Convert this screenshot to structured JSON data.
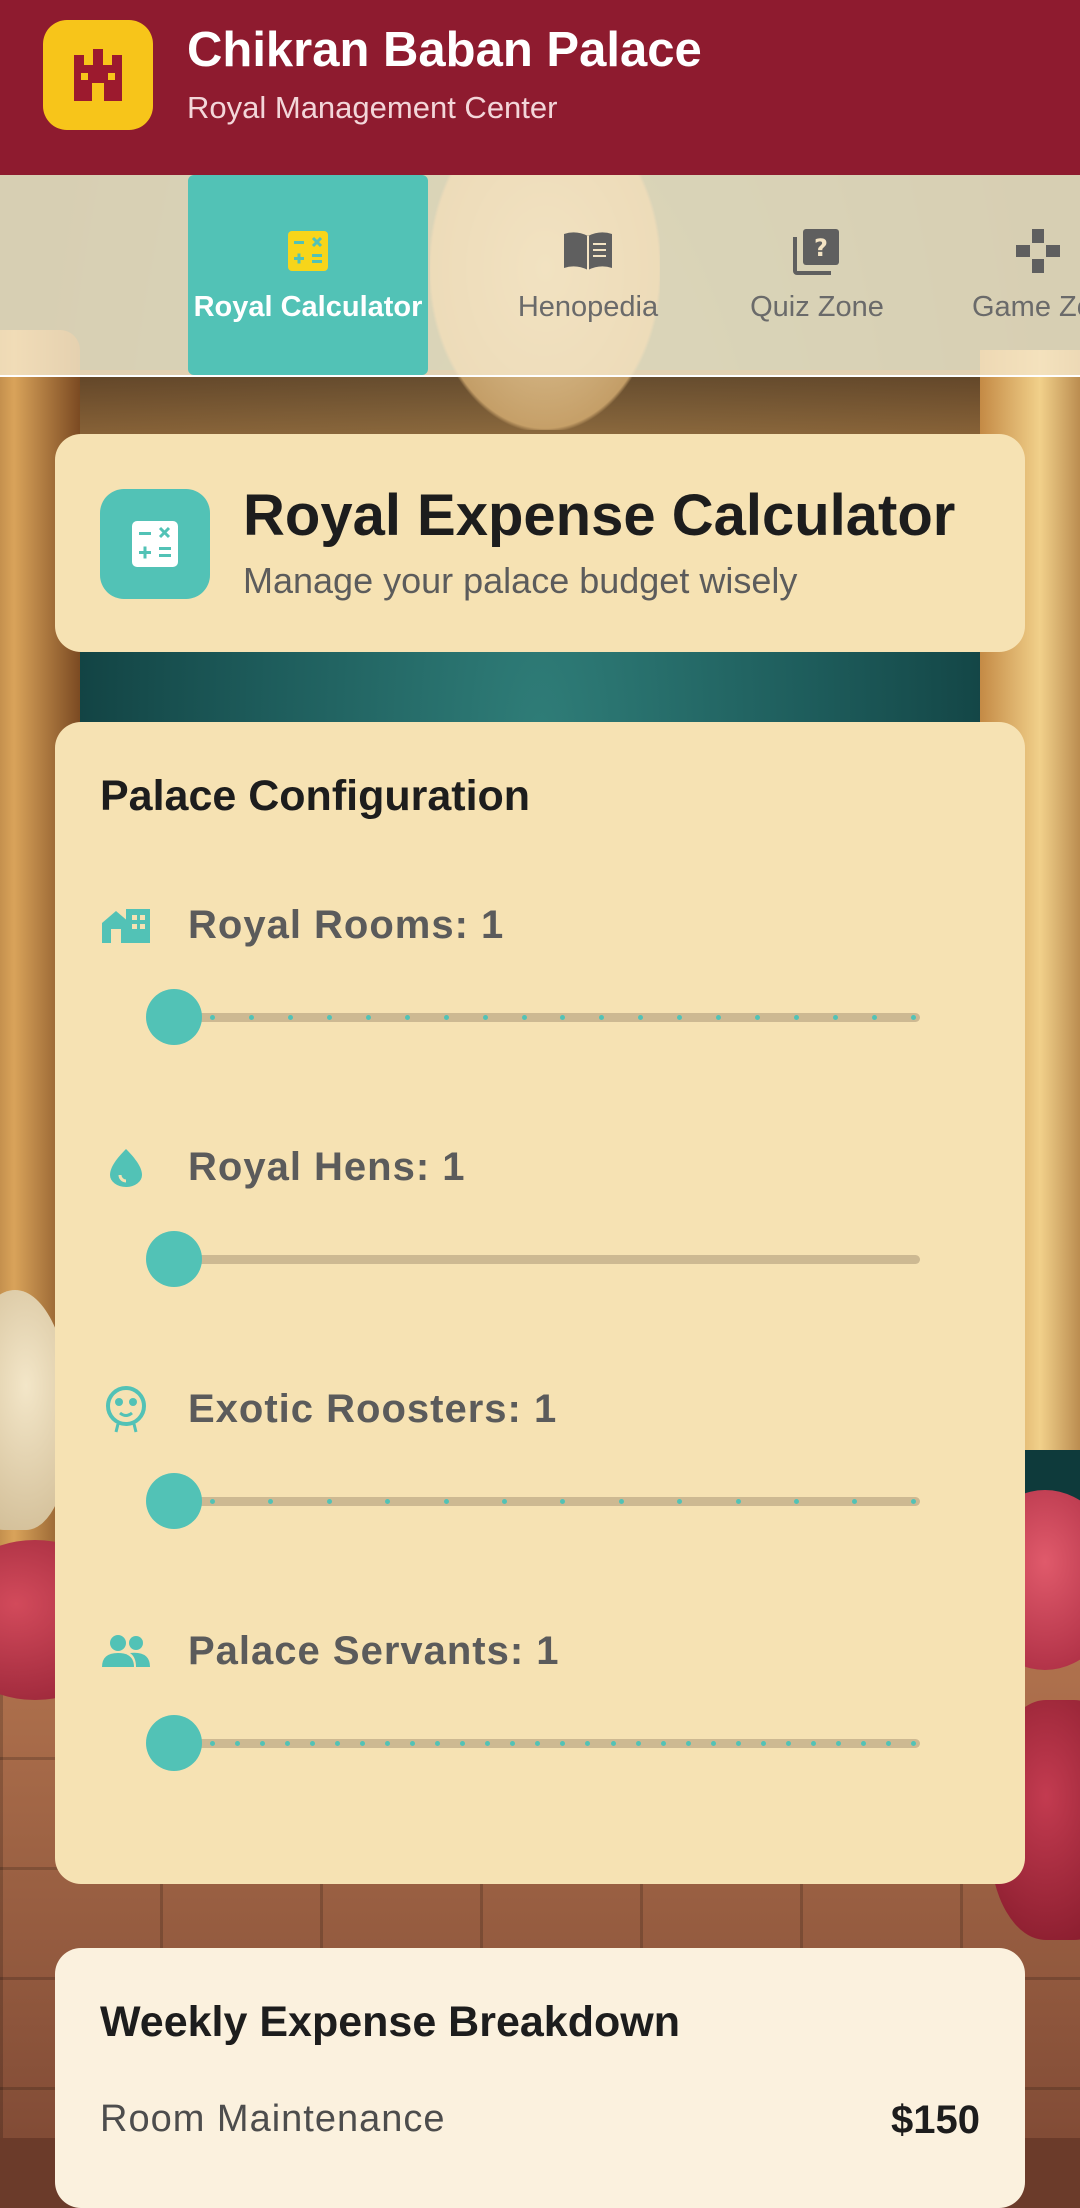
{
  "header": {
    "title": "Chikran Baban Palace",
    "subtitle": "Royal Management Center",
    "logo_icon": "castle-icon",
    "bg_color": "#8e1b2f",
    "logo_color": "#f7c51a"
  },
  "tabs": [
    {
      "label": "Royal Calculator",
      "icon": "calculator-icon",
      "active": true
    },
    {
      "label": "Henopedia",
      "icon": "book-icon",
      "active": false
    },
    {
      "label": "Quiz Zone",
      "icon": "quiz-icon",
      "active": false
    },
    {
      "label": "Game Zo",
      "icon": "gamepad-icon",
      "active": false
    }
  ],
  "calculator_header": {
    "title": "Royal Expense Calculator",
    "subtitle": "Manage your palace budget wisely",
    "icon": "calculator-icon"
  },
  "config": {
    "title": "Palace Configuration",
    "sliders": [
      {
        "label": "Royal Rooms: 1",
        "icon": "room-icon",
        "value": 1
      },
      {
        "label": "Royal Hens: 1",
        "icon": "egg-icon",
        "value": 1
      },
      {
        "label": "Exotic Roosters: 1",
        "icon": "rooster-icon",
        "value": 1
      },
      {
        "label": "Palace Servants: 1",
        "icon": "people-icon",
        "value": 1
      }
    ]
  },
  "breakdown": {
    "title": "Weekly Expense Breakdown",
    "rows": [
      {
        "label": "Room Maintenance",
        "value": "$150"
      }
    ]
  },
  "colors": {
    "accent": "#52c2b6",
    "card": "#f6e2b3"
  }
}
